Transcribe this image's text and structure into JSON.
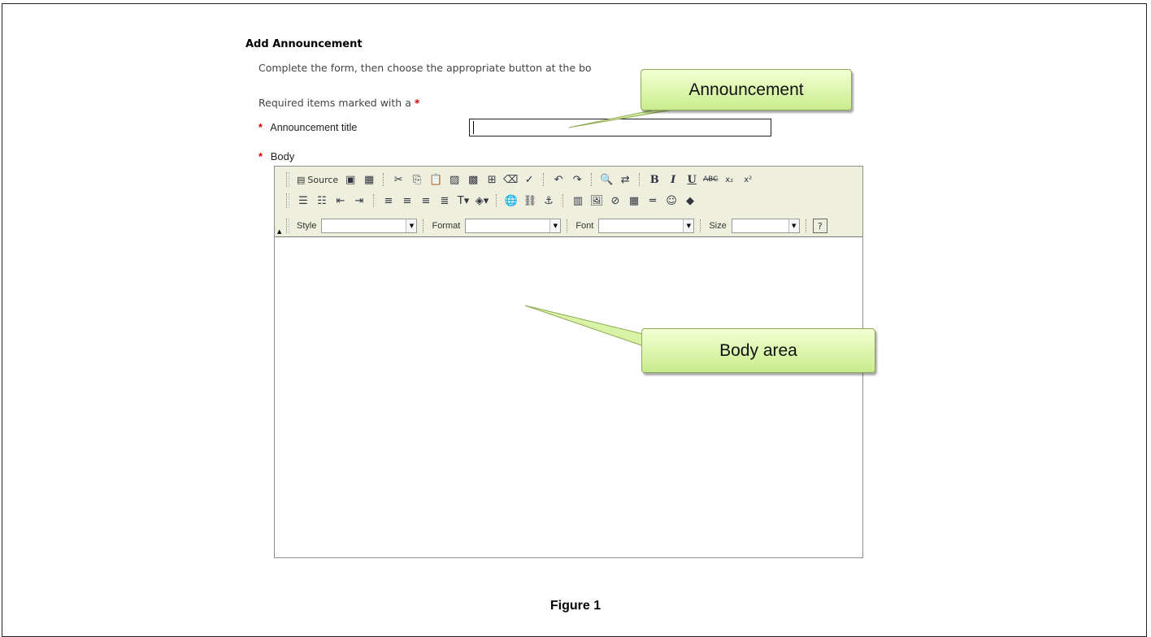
{
  "form": {
    "heading": "Add Announcement",
    "instructions": "Complete the form, then choose the appropriate button at the bo",
    "required_note": "Required items marked with a",
    "required_star": "*",
    "title_label": "Announcement title",
    "title_value": "",
    "body_label": "Body"
  },
  "editor": {
    "toolbar_row1": {
      "source_label": "Source",
      "bold": "B",
      "italic": "I",
      "underline": "U",
      "strike": "ABC",
      "subscript": "x₂",
      "superscript": "x²"
    },
    "toolbar_row3": {
      "style_label": "Style",
      "format_label": "Format",
      "font_label": "Font",
      "size_label": "Size"
    }
  },
  "callouts": {
    "announcement": "Announcement",
    "body_area": "Body area"
  },
  "caption": "Figure 1",
  "colors": {
    "required_star": "#cc0000",
    "callout_top": "#f4ffd4",
    "callout_bottom": "#c8ec8c",
    "toolbar_bg": "#efefde"
  }
}
